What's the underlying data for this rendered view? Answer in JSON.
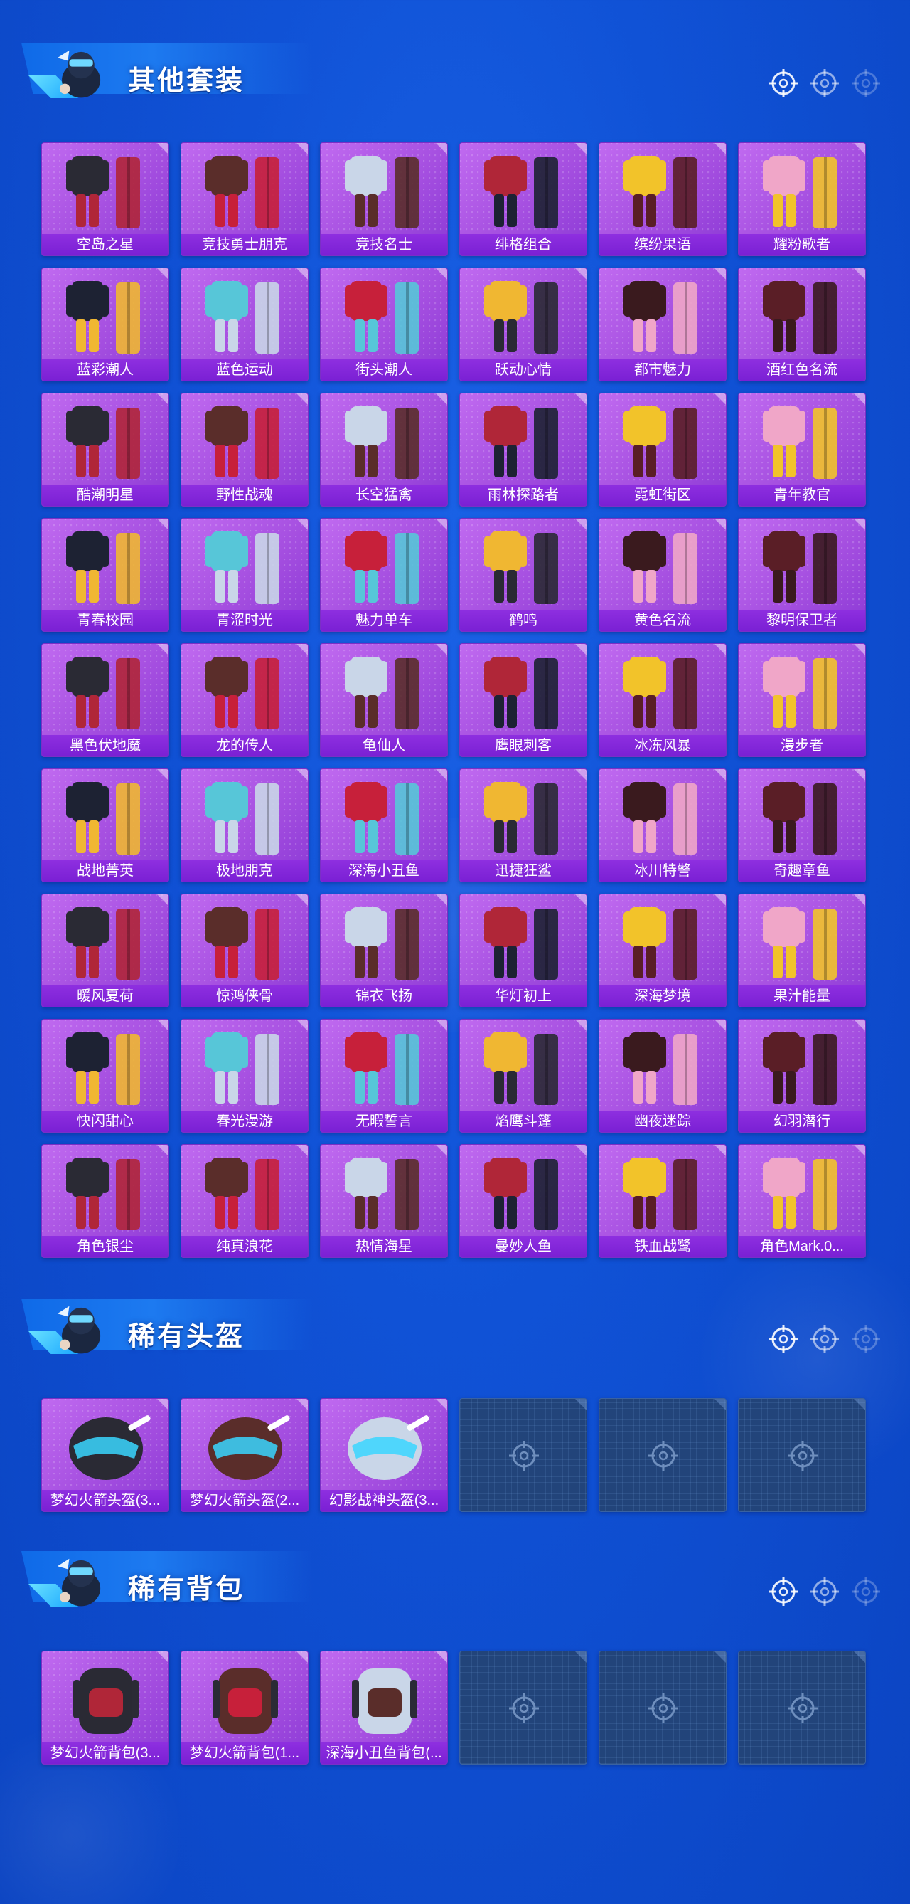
{
  "colors": {
    "background": "#1052d6",
    "card_purple": "#a54fe0",
    "label_purple": "#7a20d4",
    "empty_slot": "#22447a"
  },
  "sections": [
    {
      "title": "其他套装",
      "items": [
        {
          "name": "空岛之星"
        },
        {
          "name": "竞技勇士朋克"
        },
        {
          "name": "竞技名士"
        },
        {
          "name": "绯格组合"
        },
        {
          "name": "缤纷果语"
        },
        {
          "name": "耀粉歌者"
        },
        {
          "name": "蓝彩潮人"
        },
        {
          "name": "蓝色运动"
        },
        {
          "name": "街头潮人"
        },
        {
          "name": "跃动心情"
        },
        {
          "name": "都市魅力"
        },
        {
          "name": "酒红色名流"
        },
        {
          "name": "酷潮明星"
        },
        {
          "name": "野性战魂"
        },
        {
          "name": "长空猛禽"
        },
        {
          "name": "雨林探路者"
        },
        {
          "name": "霓虹街区"
        },
        {
          "name": "青年教官"
        },
        {
          "name": "青春校园"
        },
        {
          "name": "青涩时光"
        },
        {
          "name": "魅力单车"
        },
        {
          "name": "鹤鸣"
        },
        {
          "name": "黄色名流"
        },
        {
          "name": "黎明保卫者"
        },
        {
          "name": "黑色伏地魔"
        },
        {
          "name": "龙的传人"
        },
        {
          "name": "龟仙人"
        },
        {
          "name": "鹰眼刺客"
        },
        {
          "name": "冰冻风暴"
        },
        {
          "name": "漫步者"
        },
        {
          "name": "战地菁英"
        },
        {
          "name": "极地朋克"
        },
        {
          "name": "深海小丑鱼"
        },
        {
          "name": "迅捷狂鲨"
        },
        {
          "name": "冰川特警"
        },
        {
          "name": "奇趣章鱼"
        },
        {
          "name": "暖风夏荷"
        },
        {
          "name": "惊鸿侠骨"
        },
        {
          "name": "锦衣飞扬"
        },
        {
          "name": "华灯初上"
        },
        {
          "name": "深海梦境"
        },
        {
          "name": "果汁能量"
        },
        {
          "name": "快闪甜心"
        },
        {
          "name": "春光漫游"
        },
        {
          "name": "无暇誓言"
        },
        {
          "name": "焰鹰斗篷"
        },
        {
          "name": "幽夜迷踪"
        },
        {
          "name": "幻羽潜行"
        },
        {
          "name": "角色银尘"
        },
        {
          "name": "纯真浪花"
        },
        {
          "name": "热情海星"
        },
        {
          "name": "曼妙人鱼"
        },
        {
          "name": "铁血战鹭"
        },
        {
          "name": "角色Mark.0..."
        }
      ]
    },
    {
      "title": "稀有头盔",
      "items": [
        {
          "name": "梦幻火箭头盔(3..."
        },
        {
          "name": "梦幻火箭头盔(2..."
        },
        {
          "name": "幻影战神头盔(3..."
        }
      ],
      "empty_slots": 3
    },
    {
      "title": "稀有背包",
      "items": [
        {
          "name": "梦幻火箭背包(3..."
        },
        {
          "name": "梦幻火箭背包(1..."
        },
        {
          "name": "深海小丑鱼背包(..."
        }
      ],
      "empty_slots": 3
    }
  ]
}
